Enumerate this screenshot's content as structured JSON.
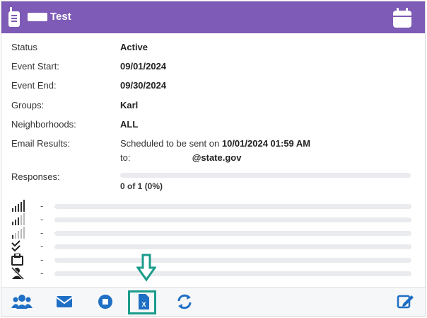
{
  "header": {
    "title": "Test",
    "icons": {
      "left": "walkie-talkie-icon",
      "right": "calendar-icon"
    },
    "bg_color": "#7e5bb6"
  },
  "fields": {
    "status_label": "Status",
    "status_value": "Active",
    "start_label": "Event Start:",
    "start_value": "09/01/2024",
    "end_label": "Event End:",
    "end_value": "09/30/2024",
    "groups_label": "Groups:",
    "groups_value": "Karl",
    "neighborhoods_label": "Neighborhoods:",
    "neighborhoods_value": "ALL",
    "email_label": "Email Results:",
    "email_sched_prefix": "Scheduled to be sent on",
    "email_sched_datetime": "10/01/2024 01:59 AM",
    "email_to_prefix": "to:",
    "email_domain": "@state.gov",
    "responses_label": "Responses:",
    "responses_count": "0 of 1",
    "responses_pct": "(0%)",
    "responses_fraction": 0
  },
  "breakdown": [
    {
      "icon": "signal-strong-icon",
      "value": "-"
    },
    {
      "icon": "signal-medium-icon",
      "value": "-"
    },
    {
      "icon": "signal-weak-icon",
      "value": "-"
    },
    {
      "icon": "double-check-icon",
      "value": "-"
    },
    {
      "icon": "briefcase-icon",
      "value": "-"
    },
    {
      "icon": "user-slash-icon",
      "value": "-"
    }
  ],
  "footer": {
    "buttons": [
      "users-icon",
      "envelope-icon",
      "stop-icon",
      "excel-file-icon",
      "sync-icon",
      "edit-icon"
    ],
    "accent_color": "#1f6fc4",
    "highlight_color": "#1a9c8c"
  }
}
